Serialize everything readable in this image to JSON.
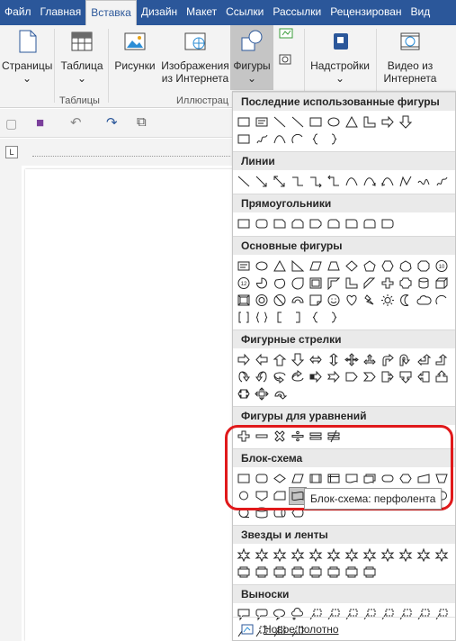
{
  "tabs": [
    "Файл",
    "Главная",
    "Вставка",
    "Дизайн",
    "Макет",
    "Ссылки",
    "Рассылки",
    "Рецензирован",
    "Вид"
  ],
  "ribbon": {
    "pages": "Страницы",
    "table": "Таблица",
    "pictures": "Рисунки",
    "online_pictures_1": "Изображения",
    "online_pictures_2": "из Интернета",
    "shapes": "Фигуры",
    "addins": "Надстройки",
    "video_1": "Видео из",
    "video_2": "Интернета",
    "group_tables": "Таблицы",
    "group_illustrations": "Иллюстрац"
  },
  "sections": [
    {
      "title": "Последние использованные фигуры",
      "rows": [
        [
          "rect",
          "textbox",
          "line",
          "line",
          "rect",
          "oval",
          "triangle",
          "lshape",
          "arrow-r",
          "arrow-d"
        ],
        [
          "flow-process",
          "scribble",
          "curve",
          "arc",
          "brace-l",
          "brace-r"
        ]
      ]
    },
    {
      "title": "Линии",
      "rows": [
        [
          "line",
          "arrow-line",
          "dbl-arrow-line",
          "elbow",
          "elbow-arrow",
          "elbow-dbl",
          "curve",
          "curve-arrow",
          "curve-dbl",
          "freeform",
          "scribble2",
          "scribble"
        ]
      ]
    },
    {
      "title": "Прямоугольники",
      "rows": [
        [
          "rect",
          "round-rect",
          "snip1",
          "snip2",
          "snip3",
          "snip-round",
          "round1",
          "round2",
          "round3"
        ]
      ]
    },
    {
      "title": "Основные фигуры",
      "rows": [
        [
          "textbox",
          "oval",
          "triangle",
          "rtriangle",
          "parallelogram",
          "trapezoid",
          "diamond",
          "pentagon",
          "hexagon",
          "heptagon",
          "octagon",
          "decagon"
        ],
        [
          "dodecagon",
          "pie",
          "chord",
          "teardrop",
          "frame",
          "halfframe",
          "lshape",
          "diag-stripe",
          "cross",
          "plaque",
          "can",
          "cube"
        ],
        [
          "bevel",
          "donut",
          "no-symbol",
          "block-arc",
          "folded",
          "smiley",
          "heart",
          "lightning",
          "sun",
          "moon",
          "cloud",
          "arc"
        ],
        [
          "dbl-bracket",
          "dbl-brace",
          "bracket-l",
          "bracket-r",
          "brace-l",
          "brace-r"
        ]
      ]
    },
    {
      "title": "Фигурные стрелки",
      "rows": [
        [
          "arrow-r",
          "arrow-l",
          "arrow-u",
          "arrow-d",
          "arrow-lr",
          "arrow-ud",
          "quad",
          "lru",
          "bent",
          "uturn",
          "lup",
          "bentup"
        ],
        [
          "curved-r",
          "curved-l",
          "curved-u",
          "curved-d",
          "striped",
          "notched",
          "pentagon-arrow",
          "chevron",
          "callout-r",
          "callout-d",
          "callout-l",
          "callout-u"
        ],
        [
          "callout-lr",
          "callout-quad",
          "circular"
        ]
      ]
    },
    {
      "title": "Фигуры для уравнений",
      "rows": [
        [
          "plus",
          "minus",
          "multiply",
          "divide",
          "equal",
          "notequal"
        ]
      ]
    },
    {
      "title": "Блок-схема",
      "rows": [
        [
          "flow-process",
          "flow-alt",
          "flow-decision",
          "flow-data",
          "flow-predefined",
          "flow-internal",
          "flow-document",
          "flow-multidoc",
          "flow-terminator",
          "flow-prep",
          "flow-manual-input",
          "flow-manual-op"
        ],
        [
          "flow-connector",
          "flow-offpage",
          "flow-card",
          "flow-tape",
          "flow-summing",
          "flow-or",
          "flow-collate",
          "flow-sort",
          "flow-extract",
          "flow-merge",
          "flow-stored",
          "flow-delay"
        ],
        [
          "flow-seq",
          "flow-disk",
          "flow-direct",
          "flow-display"
        ]
      ]
    },
    {
      "title": "Звезды и ленты",
      "rows": [
        [
          "exp1",
          "exp2",
          "star4",
          "star5",
          "star6",
          "star7",
          "star8",
          "star10",
          "star12",
          "star16",
          "star24",
          "star32"
        ],
        [
          "ribbon-up",
          "ribbon-down",
          "curved-up",
          "curved-down",
          "vert-scroll",
          "horiz-scroll",
          "wave",
          "dbl-wave"
        ]
      ]
    },
    {
      "title": "Выноски",
      "rows": [
        [
          "callout-rect",
          "callout-round",
          "callout-oval",
          "callout-cloud",
          "line-callout1",
          "line-callout2",
          "line-callout3",
          "line-callout4",
          "line-callout5",
          "line-callout6",
          "line-callout7",
          "line-callout8"
        ],
        [
          "line-callout9",
          "line-callout10",
          "line-callout11",
          "line-callout12"
        ]
      ]
    }
  ],
  "new_canvas": "Новое полотно",
  "tooltip": "Блок-схема: перфолента",
  "accent": "#2b579a"
}
